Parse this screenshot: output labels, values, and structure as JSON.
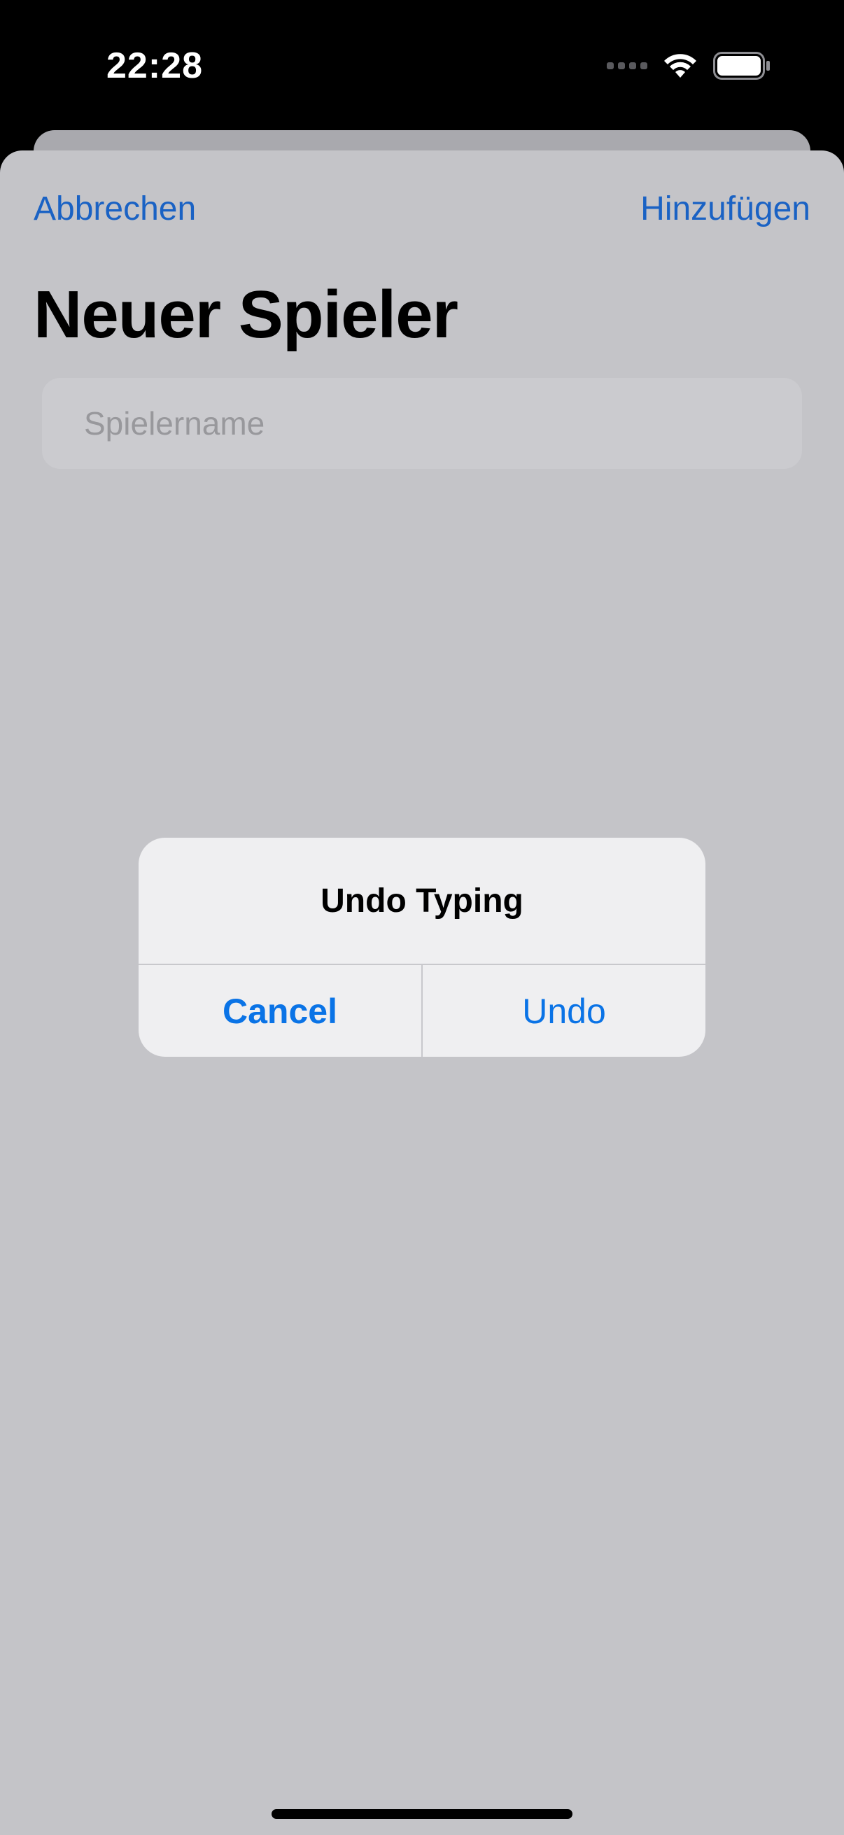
{
  "status_bar": {
    "time": "22:28",
    "icons": [
      "cellular-signal-icon",
      "wifi-icon",
      "battery-icon"
    ]
  },
  "navigation": {
    "cancel_label": "Abbrechen",
    "add_label": "Hinzufügen"
  },
  "page": {
    "title": "Neuer Spieler"
  },
  "player_name_field": {
    "placeholder": "Spielername",
    "value": ""
  },
  "alert": {
    "title": "Undo Typing",
    "cancel_label": "Cancel",
    "undo_label": "Undo"
  },
  "colors": {
    "accent": "#0a73e6",
    "nav_link": "#1a62c4",
    "sheet_background": "#c4c4c8",
    "alert_background": "#efeff1"
  }
}
